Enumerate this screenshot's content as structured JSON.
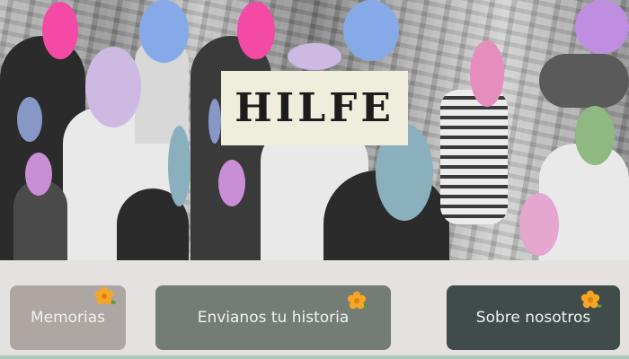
{
  "hero": {
    "title": "HILFE"
  },
  "nav": [
    {
      "label": "Memorias",
      "color": "#aea6a3",
      "icon": "flower-icon"
    },
    {
      "label": "Envianos tu historia",
      "color": "#737d76",
      "icon": "flower-icon"
    },
    {
      "label": "Sobre nosotros",
      "color": "#3f4c49",
      "icon": "flower-icon"
    }
  ],
  "colors": {
    "background": "#e6e1e1",
    "title_box": "#efeedd",
    "flower": "#f6a623",
    "bottom_strip": "#a9c8b8"
  }
}
